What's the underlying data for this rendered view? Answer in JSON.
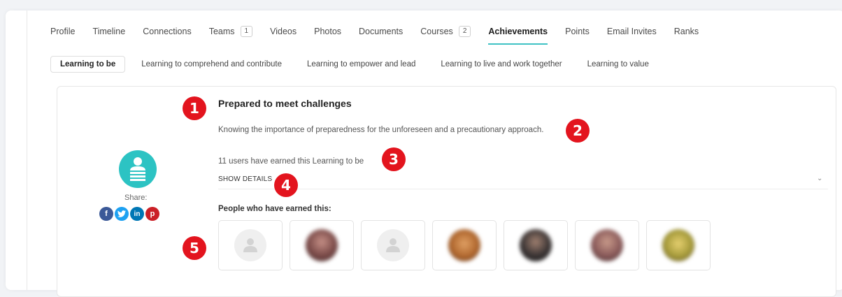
{
  "nav": {
    "tabs": [
      {
        "label": "Profile"
      },
      {
        "label": "Timeline"
      },
      {
        "label": "Connections"
      },
      {
        "label": "Teams",
        "count": "1"
      },
      {
        "label": "Videos"
      },
      {
        "label": "Photos"
      },
      {
        "label": "Documents"
      },
      {
        "label": "Courses",
        "count": "2"
      },
      {
        "label": "Achievements"
      },
      {
        "label": "Points"
      },
      {
        "label": "Email Invites"
      },
      {
        "label": "Ranks"
      }
    ],
    "active": "Achievements"
  },
  "subtabs": {
    "items": [
      {
        "label": "Learning to be"
      },
      {
        "label": "Learning to comprehend and contribute"
      },
      {
        "label": "Learning to empower and lead"
      },
      {
        "label": "Learning to live and work together"
      },
      {
        "label": "Learning to value"
      }
    ],
    "active": "Learning to be"
  },
  "achievement": {
    "title": "Prepared to meet challenges",
    "description": "Knowing the importance of preparedness for the unforeseen and a precautionary approach.",
    "earned_count": "11 users have earned this Learning to be",
    "show_details": "SHOW DETAILS",
    "share_label": "Share:",
    "share_icons": [
      {
        "icon": "facebook-icon",
        "glyph": "f",
        "color": "#3b5998"
      },
      {
        "icon": "twitter-icon",
        "glyph": "t",
        "color": "#1da1f2"
      },
      {
        "icon": "linkedin-icon",
        "glyph": "in",
        "color": "#0077b5"
      },
      {
        "icon": "pinterest-icon",
        "glyph": "p",
        "color": "#cb2027"
      }
    ],
    "accent_color": "#2cc3c3",
    "people_heading": "People who have earned this:",
    "people": [
      {
        "type": "placeholder"
      },
      {
        "type": "photo",
        "color": "#7a4a48"
      },
      {
        "type": "placeholder"
      },
      {
        "type": "photo",
        "color": "#b0672e"
      },
      {
        "type": "photo",
        "color": "#3a3434"
      },
      {
        "type": "photo",
        "color": "#8a5a5a"
      },
      {
        "type": "photo",
        "color": "#a59a3a"
      }
    ]
  },
  "markers": [
    "1",
    "2",
    "3",
    "4",
    "5"
  ]
}
